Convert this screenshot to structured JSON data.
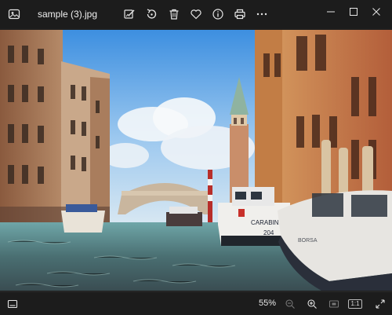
{
  "titlebar": {
    "file_name": "sample (3).jpg",
    "app_icon": "photos-app-icon",
    "toolbar_icons": [
      "edit-image-icon",
      "rotate-icon",
      "delete-icon",
      "favorite-heart-icon",
      "info-icon",
      "print-icon",
      "more-icon"
    ],
    "window_controls": [
      "minimize-icon",
      "maximize-icon",
      "close-icon"
    ]
  },
  "statusbar": {
    "zoom_level": "55%",
    "ratio_label": "1:1",
    "icons": [
      "filmstrip-icon",
      "zoom-out-icon",
      "zoom-in-icon",
      "fit-window-icon",
      "actual-size-icon",
      "fullscreen-icon"
    ]
  },
  "photo": {
    "boat_name": "CARABINIERI",
    "boat_number": "204"
  },
  "colors": {
    "chrome_bg": "#1c1c1c",
    "icon": "#e6e6e6",
    "disabled_icon": "#777777"
  }
}
